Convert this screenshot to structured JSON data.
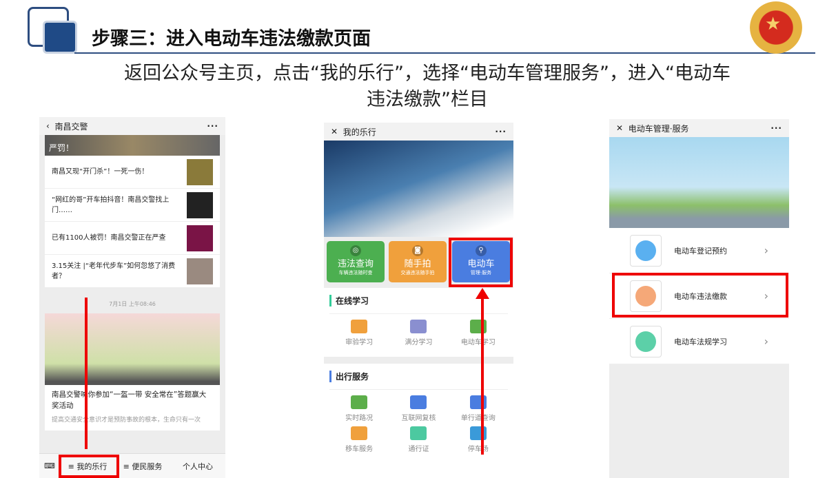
{
  "slide": {
    "title": "步骤三：进入电动车违法缴款页面",
    "subtitle_line1": "返回公众号主页，点击“我的乐行”，选择“电动车管理服务”，进入“电动车",
    "subtitle_line2": "违法缴款”栏目"
  },
  "phone1": {
    "title": "南昌交警",
    "more": "···",
    "banner_text": "严罚！",
    "news": [
      "南昌又现“开门杀”！一死一伤！",
      "“网红的哥”开车拍抖音！南昌交警找上门……",
      "已有1100人被罚！南昌交警正在严查",
      "3.15关注 |“老年代步车”如何忽悠了消费者？"
    ],
    "timestamp": "7月1日 上午08:46",
    "article_title": "南昌交警喊你参加“一盔一带 安全常在”答题赢大奖活动",
    "article_desc": "提高交通安全意识才是预防事故的根本，生命只有一次",
    "menu": [
      "≡ 我的乐行",
      "≡ 便民服务",
      "个人中心"
    ]
  },
  "phone2": {
    "title": "我的乐行",
    "close": "✕",
    "more": "···",
    "tiles": [
      {
        "title": "违法查询",
        "sub": "车辆违法随时查",
        "color": "#4caf50"
      },
      {
        "title": "随手拍",
        "sub": "交通违法随手拍",
        "color": "#f0a03c"
      },
      {
        "title": "电动车",
        "sub": "管理·服务",
        "color": "#4a7de0"
      }
    ],
    "section1": "在线学习",
    "study": [
      "审验学习",
      "满分学习",
      "电动车学习"
    ],
    "section2": "出行服务",
    "services": [
      "实时路况",
      "互联网复核",
      "单行道查询",
      "移车服务",
      "通行证",
      "停车场"
    ]
  },
  "phone3": {
    "title": "电动车管理·服务",
    "close": "✕",
    "more": "···",
    "items": [
      "电动车登记预约",
      "电动车违法缴款",
      "电动车法规学习"
    ],
    "chev": "›"
  }
}
